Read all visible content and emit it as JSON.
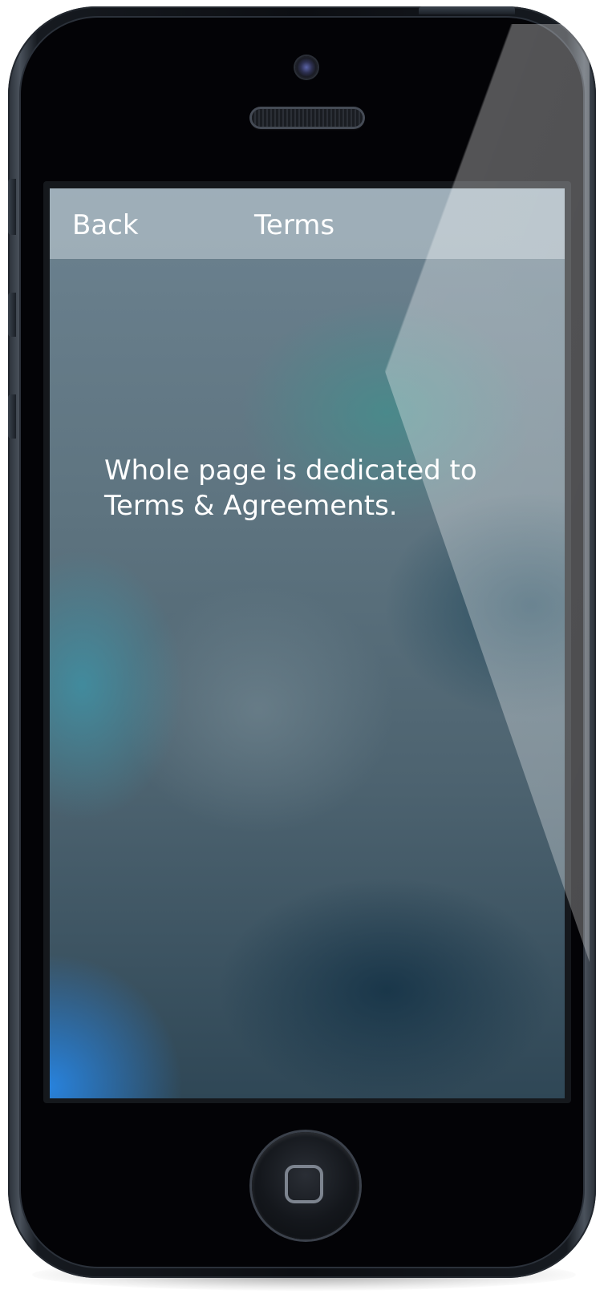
{
  "nav": {
    "back_label": "Back",
    "title": "Terms"
  },
  "content": {
    "text": "Whole page is dedicated to Terms & Agreements."
  },
  "device": {
    "home_icon": "home-square-icon",
    "camera_icon": "front-camera-icon",
    "speaker_icon": "earpiece-speaker-icon"
  },
  "colors": {
    "text": "#ffffff",
    "device_body": "#0c0e12",
    "nav_bar_tint": "#c8d4da"
  }
}
